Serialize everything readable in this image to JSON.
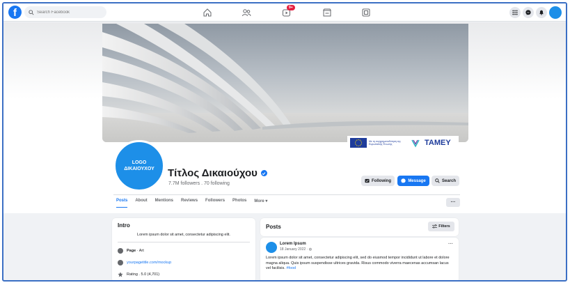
{
  "topnav": {
    "search_placeholder": "Search Facebook",
    "notif_badge": "9+",
    "fb_logo": "f"
  },
  "cover": {
    "eu_text": "Με τη συγχρηματοδότηση της Ευρωπαϊκής Ένωσης",
    "tamey": "TAMEY"
  },
  "profile": {
    "logo_line1": "LOGO",
    "logo_line2": "ΔΙΚΑΙΟΥΧΟΥ",
    "title": "Τίτλος Δικαιούχου",
    "followers": "7.7M followers . 70 following"
  },
  "actions": {
    "following": "Following",
    "message": "Message",
    "search": "Search",
    "more": "···"
  },
  "tabs": [
    "Posts",
    "About",
    "Mentions",
    "Reviews",
    "Followers",
    "Photos",
    "More ▾"
  ],
  "intro": {
    "title": "Intro",
    "bio": "Lorem ipsum dolor sit amet, consectetur adipiscing elit.",
    "page_label": "Page",
    "page_type": " · Art",
    "website": "yourpagetitle.com/mockup",
    "rating": "Rating . 5.0 (4,701)"
  },
  "posts": {
    "title": "Posts",
    "filters": "Filters"
  },
  "post": {
    "author": "Lorem Ipsum",
    "date": "18 January 2022 · ◍",
    "more": "···",
    "body": "Lorem ipsum dolor sit amet, consectetur adipiscing elit, sed do eiusmod tempor incididunt ut labore et dolore magna aliqua. Quis ipsum suspendisse ultrices gravida. Risus commodo viverra maecenas accumsan lacus vel facilisis.",
    "hashtag": "#food"
  },
  "colors": {
    "brand": "#1877f2",
    "logo_blue": "#1d8fe8",
    "badge_red": "#e41e3f"
  },
  "icons": [
    "facebook-logo-icon",
    "search-icon",
    "home-icon",
    "friends-icon",
    "video-icon",
    "marketplace-icon",
    "groups-icon",
    "menu-grid-icon",
    "messenger-icon",
    "bell-icon",
    "verified-icon"
  ]
}
